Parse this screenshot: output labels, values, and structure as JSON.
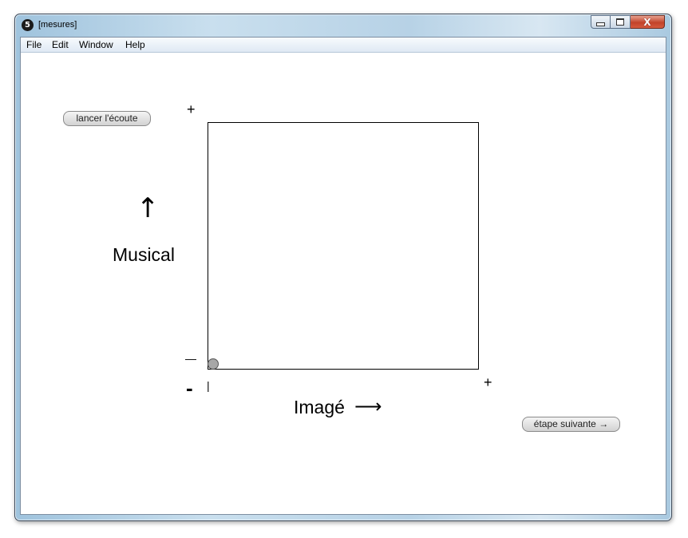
{
  "window": {
    "title": "[mesures]",
    "app_badge": "5",
    "close_glyph": "X"
  },
  "menu": {
    "items": [
      "File",
      "Edit",
      "Window",
      "Help"
    ]
  },
  "controls": {
    "listen_button": "lancer l'écoute",
    "next_button": "étape suivante →"
  },
  "axes": {
    "y_label": "Musical",
    "y_arrow": "↑",
    "x_label": "Imagé",
    "x_arrow": "⟶",
    "plus": "+",
    "minus": "-",
    "y_min_tick": "—",
    "x_min_tick": "|"
  },
  "cursor": {
    "image_level": 0,
    "musical_level": 0
  },
  "colors": {
    "cursor_fill": "#a7a7a7",
    "close_button": "#c2432a"
  }
}
